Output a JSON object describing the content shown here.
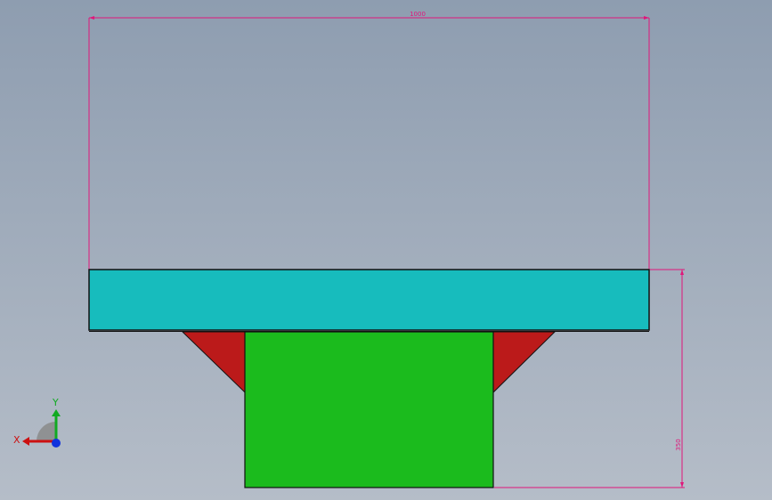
{
  "viewport": {
    "background_top": "#8e9db0",
    "background_bottom": "#b5bdc8"
  },
  "model": {
    "flange_color": "#17bcbd",
    "web_color": "#1bbb1d",
    "gusset_color": "#bb1a1a",
    "outline_color": "#111111"
  },
  "dimensions": {
    "color": "#e0167a",
    "width_label": "1000",
    "height_label": "350"
  },
  "triad": {
    "x_label": "X",
    "y_label": "Y",
    "x_color": "#cc1111",
    "y_color": "#11aa22",
    "z_color": "#1133dd"
  }
}
